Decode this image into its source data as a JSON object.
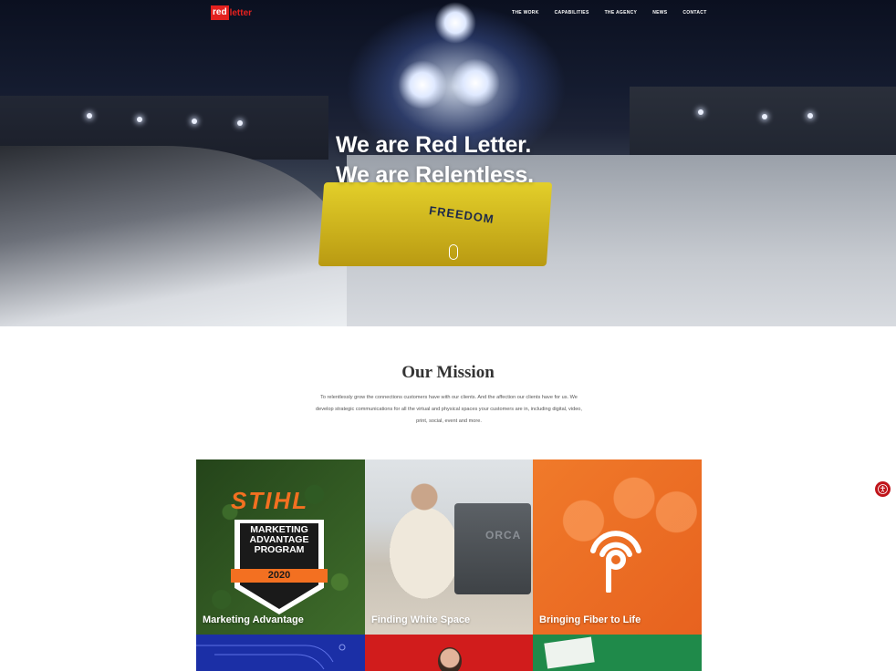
{
  "header": {
    "logo": {
      "mark": "red",
      "word": "letter"
    },
    "nav": [
      "THE WORK",
      "CAPABILITIES",
      "THE AGENCY",
      "NEWS",
      "CONTACT"
    ]
  },
  "hero": {
    "line1": "We are Red Letter.",
    "line2": "We are Relentless.",
    "plow_text": "FREEDOM"
  },
  "mission": {
    "title": "Our Mission",
    "text": "To relentlessly grow the connections customers have with our clients. And the affection our clients have for us. We develop strategic communications for all the virtual and physical spaces your customers are in, including digital, video, print, social, event and more."
  },
  "tiles": [
    {
      "label": "Marketing Advantage",
      "brand": "STIHL",
      "badge": "MARKETING ADVANTAGE PROGRAM",
      "year": "2020"
    },
    {
      "label": "Finding White Space",
      "brand": "ORCA"
    },
    {
      "label": "Bringing Fiber to Life"
    }
  ],
  "colors": {
    "brand_red": "#e3211f",
    "stihl_orange": "#f37021",
    "fiber_orange": "#e96a22",
    "tile_blue": "#1b2fa6",
    "tile_red": "#d11c1c",
    "tile_green": "#1f8a4a"
  },
  "icons": {
    "scroll": "mouse-scroll-icon",
    "accessibility": "accessibility-icon"
  }
}
